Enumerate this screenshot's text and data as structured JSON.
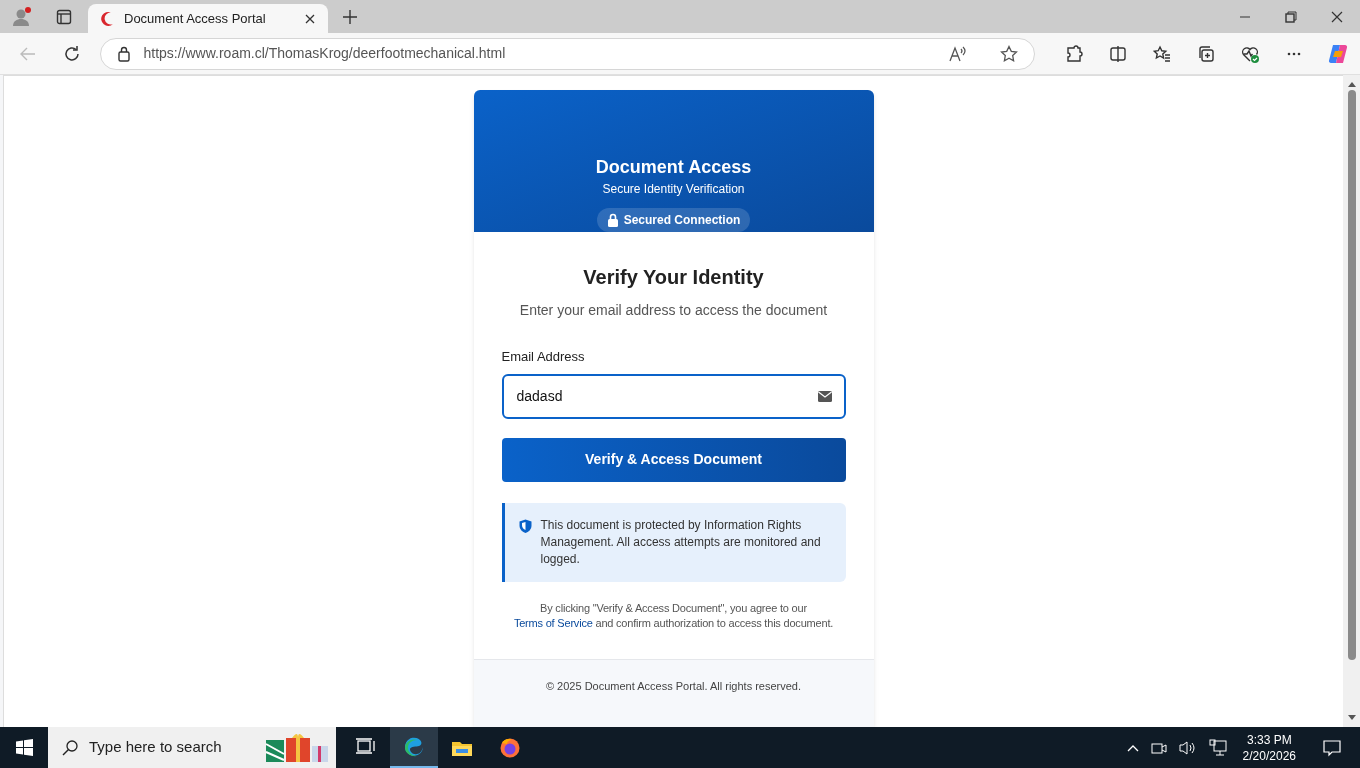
{
  "browser": {
    "tab": {
      "title": "Document Access Portal"
    },
    "url": "https://www.roam.cl/ThomasKrog/deerfootmechanical.html"
  },
  "header": {
    "title": "Document Access",
    "subtitle": "Secure Identity Verification",
    "badge": "Secured Connection"
  },
  "form": {
    "heading": "Verify Your Identity",
    "intro": "Enter your email address to access the document",
    "field_label": "Email Address",
    "value": "dadasd",
    "button": "Verify & Access Document"
  },
  "notice": "This document is protected by Information Rights Management. All access attempts are monitored and logged.",
  "consent": {
    "before": "By clicking \"Verify & Access Document\", you agree to our",
    "link": "Terms of Service",
    "after": "and confirm authorization to access this document."
  },
  "footer": {
    "copyright": "© 2025 Document Access Portal. All rights reserved."
  },
  "taskbar": {
    "search_placeholder": "Type here to search",
    "apps": [
      {
        "kind": "taskview",
        "selected": false
      },
      {
        "kind": "edge",
        "selected": true
      },
      {
        "kind": "files",
        "selected": false
      },
      {
        "kind": "firefox",
        "selected": false
      }
    ],
    "time": "3:33 PM",
    "date": "2/20/2026"
  }
}
